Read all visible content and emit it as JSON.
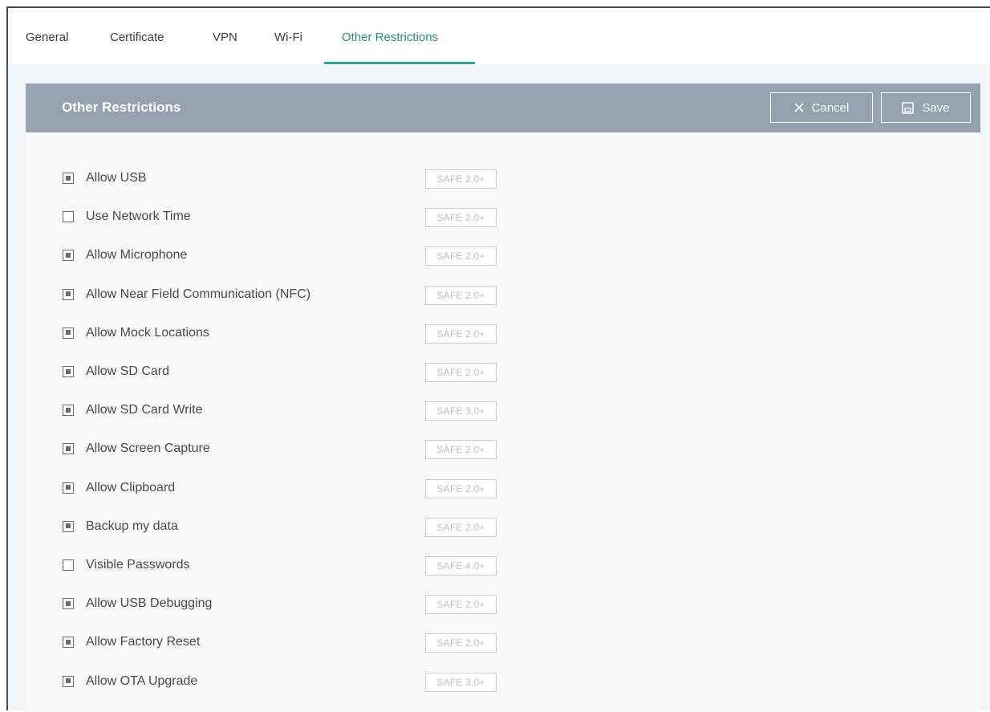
{
  "tabs": [
    {
      "label": "General",
      "active": false
    },
    {
      "label": "Certificate",
      "active": false
    },
    {
      "label": "VPN",
      "active": false
    },
    {
      "label": "Wi-Fi",
      "active": false
    },
    {
      "label": "Other Restrictions",
      "active": true
    }
  ],
  "panel": {
    "title": "Other Restrictions",
    "cancel_label": "Cancel",
    "save_label": "Save"
  },
  "restrictions": [
    {
      "label": "Allow USB",
      "checked": true,
      "badge": "SAFE 2.0+"
    },
    {
      "label": "Use Network Time",
      "checked": false,
      "badge": "SAFE 2.0+"
    },
    {
      "label": "Allow Microphone",
      "checked": true,
      "badge": "SAFE 2.0+"
    },
    {
      "label": "Allow Near Field Communication (NFC)",
      "checked": true,
      "badge": "SAFE 2.0+"
    },
    {
      "label": "Allow Mock Locations",
      "checked": true,
      "badge": "SAFE 2.0+"
    },
    {
      "label": "Allow SD Card",
      "checked": true,
      "badge": "SAFE 2.0+"
    },
    {
      "label": "Allow SD Card Write",
      "checked": true,
      "badge": "SAFE 3.0+"
    },
    {
      "label": "Allow Screen Capture",
      "checked": true,
      "badge": "SAFE 2.0+"
    },
    {
      "label": "Allow Clipboard",
      "checked": true,
      "badge": "SAFE 2.0+"
    },
    {
      "label": "Backup my data",
      "checked": true,
      "badge": "SAFE 2.0+"
    },
    {
      "label": "Visible Passwords",
      "checked": false,
      "badge": "SAFE 4.0+"
    },
    {
      "label": "Allow USB Debugging",
      "checked": true,
      "badge": "SAFE 2.0+"
    },
    {
      "label": "Allow Factory Reset",
      "checked": true,
      "badge": "SAFE 2.0+"
    },
    {
      "label": "Allow OTA Upgrade",
      "checked": true,
      "badge": "SAFE 3.0+"
    }
  ],
  "colors": {
    "accent": "#2aa58e",
    "header_bg": "#95a3b0"
  },
  "icons": {
    "cancel": "close-icon",
    "save": "floppy-disk-icon"
  }
}
